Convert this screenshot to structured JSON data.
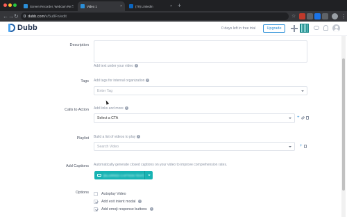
{
  "browser": {
    "tabs": [
      {
        "label": "Screen Recorder, Webcam Re...",
        "active": false
      },
      {
        "label": "Video 1",
        "active": true
      },
      {
        "label": "(79) LinkedIn",
        "active": false
      }
    ],
    "close_glyph": "×",
    "new_tab_glyph": "+",
    "url_host": "dubb.com",
    "url_path": "/v/5u8Fn/edit"
  },
  "header": {
    "brand": "Dubb",
    "trial_text": "0 days left in free trial",
    "upgrade_label": "Upgrade"
  },
  "form": {
    "description": {
      "label": "Description",
      "help": "Add text under your video"
    },
    "tags": {
      "label": "Tags",
      "help": "Add tags for internal organization",
      "placeholder": "Enter Tag"
    },
    "cta": {
      "label": "Calls to Action",
      "help": "Add links and more",
      "value": "Select a CTA"
    },
    "playlist": {
      "label": "Playlist",
      "help": "Build a list of videos to play",
      "placeholder": "Search Video"
    },
    "captions": {
      "label": "Add Captions",
      "help": "Automatically generate closed captions on your video to improve comprehension rates.",
      "button": "[BLURRED CAPTION TEXT]"
    },
    "options": {
      "label": "Options",
      "items": [
        {
          "label": "Autoplay Video",
          "checked": false
        },
        {
          "label": "Add exit intent modal",
          "checked": true
        },
        {
          "label": "Add emoji response buttons",
          "checked": true
        }
      ]
    }
  },
  "colors": {
    "accent": "#2b8fd8",
    "caption_button": "#17b3b3",
    "brand_dark": "#1a2b49"
  }
}
